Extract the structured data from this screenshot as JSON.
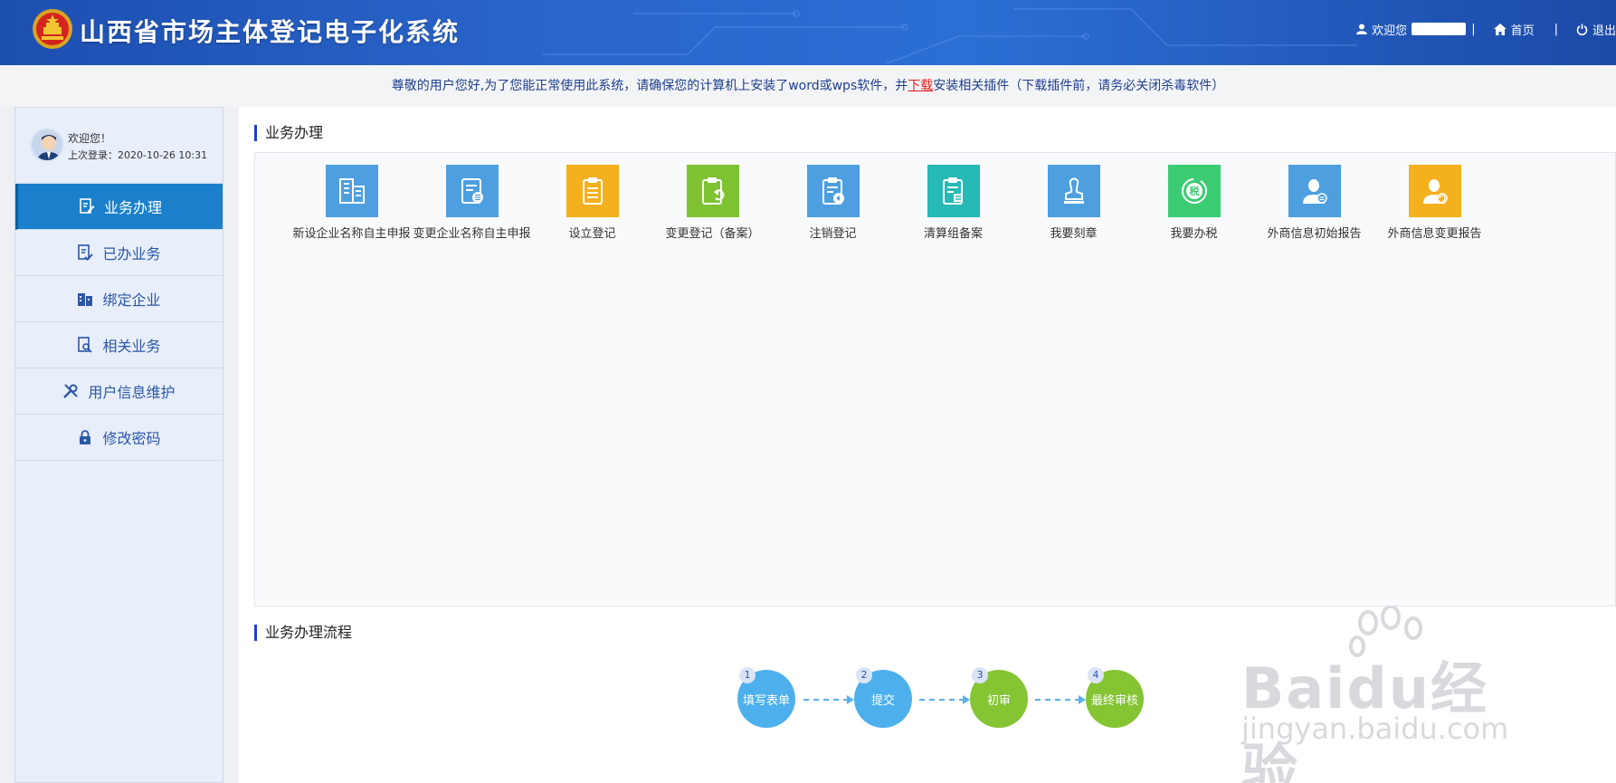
{
  "header": {
    "title": "山西省市场主体登记电子化系统",
    "welcome": "欢迎您",
    "home": "首页",
    "logout": "退出"
  },
  "notice": {
    "pre": "尊敬的用户您好,为了您能正常使用此系统，请确保您的计算机上安装了word或wps软件，并",
    "link": "下载",
    "post": "安装相关插件（下载插件前，请务必关闭杀毒软件）"
  },
  "sidebar": {
    "welcome": "欢迎您！",
    "last_login": "上次登录：2020-10-26 10:31",
    "items": [
      {
        "label": "业务办理",
        "icon": "edit-doc-icon"
      },
      {
        "label": "已办业务",
        "icon": "checked-doc-icon"
      },
      {
        "label": "绑定企业",
        "icon": "building-icon"
      },
      {
        "label": "相关业务",
        "icon": "search-doc-icon"
      },
      {
        "label": "用户信息维护",
        "icon": "wrench-icon"
      },
      {
        "label": "修改密码",
        "icon": "lock-icon"
      }
    ]
  },
  "main": {
    "business_title": "业务办理",
    "flow_title": "业务办理流程",
    "business_items": [
      {
        "label": "新设企业名称自主申报",
        "color": "#4d9fe0",
        "icon": "building-doc-icon"
      },
      {
        "label": "变更企业名称自主申报",
        "color": "#4d9fe0",
        "icon": "list-doc-icon"
      },
      {
        "label": "设立登记",
        "color": "#f5b01d",
        "icon": "clipboard-icon"
      },
      {
        "label": "变更登记（备案）",
        "color": "#7ec231",
        "icon": "clipboard-refresh-icon"
      },
      {
        "label": "注销登记",
        "color": "#4d9fe0",
        "icon": "clipboard-cancel-icon"
      },
      {
        "label": "清算组备案",
        "color": "#26b9b5",
        "icon": "clipboard-stamp-icon"
      },
      {
        "label": "我要刻章",
        "color": "#4d9fe0",
        "icon": "seal-icon"
      },
      {
        "label": "我要办税",
        "color": "#3bcc74",
        "icon": "tax-icon"
      },
      {
        "label": "外商信息初始报告",
        "color": "#4d9fe0",
        "icon": "foreign-person-icon"
      },
      {
        "label": "外商信息变更报告",
        "color": "#f5b01d",
        "icon": "foreign-person-refresh-icon"
      }
    ],
    "flow_steps": [
      {
        "num": "1",
        "label": "填写表单",
        "color": "#4db0ec"
      },
      {
        "num": "2",
        "label": "提交",
        "color": "#4db0ec"
      },
      {
        "num": "3",
        "label": "初审",
        "color": "#85c433"
      },
      {
        "num": "4",
        "label": "最终审核",
        "color": "#85c433"
      }
    ]
  },
  "watermark": {
    "brand": "Baidu经验",
    "url": "jingyan.baidu.com"
  }
}
